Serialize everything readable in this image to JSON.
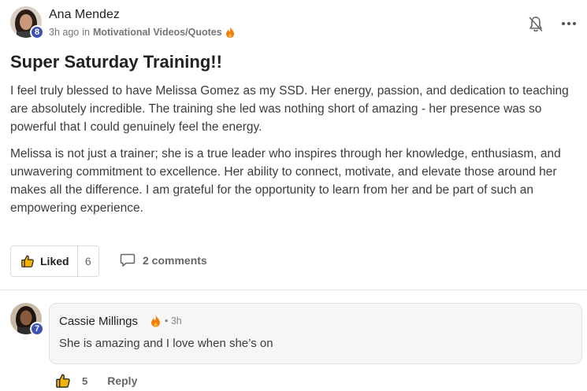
{
  "post": {
    "author": "Ana Mendez",
    "author_level": "8",
    "time": "3h ago",
    "in_label": "in",
    "category": "Motivational Videos/Quotes",
    "title": "Super Saturday Training!!",
    "paragraphs": [
      "I feel truly blessed to have Melissa Gomez as my SSD. Her energy, passion, and dedication to teaching are absolutely incredible. The training she led was nothing short of amazing - her presence was so powerful that I could genuinely feel the energy.",
      "Melissa is not just a trainer; she is a true leader who inspires through her knowledge, enthusiasm, and unwavering commitment to excellence. Her ability to connect, motivate, and elevate those around her makes all the difference. I am grateful for the opportunity to learn from her and be part of such an empowering experience."
    ],
    "like_label": "Liked",
    "like_count": "6",
    "comments_label": "2 comments"
  },
  "comment": {
    "author": "Cassie Millings",
    "author_level": "7",
    "time": "• 3h",
    "text": "She is amazing and I love when she’s on",
    "like_count": "5",
    "reply_label": "Reply"
  },
  "icons": {
    "flame": "flame-icon",
    "bell": "bell-off-icon",
    "more": "more-horizontal-icon",
    "like": "thumbs-up-icon",
    "comment": "comment-bubble-icon"
  },
  "colors": {
    "level_badge": "#3f51b5",
    "flame": "#f57c00",
    "like_icon": "#f5b400"
  }
}
